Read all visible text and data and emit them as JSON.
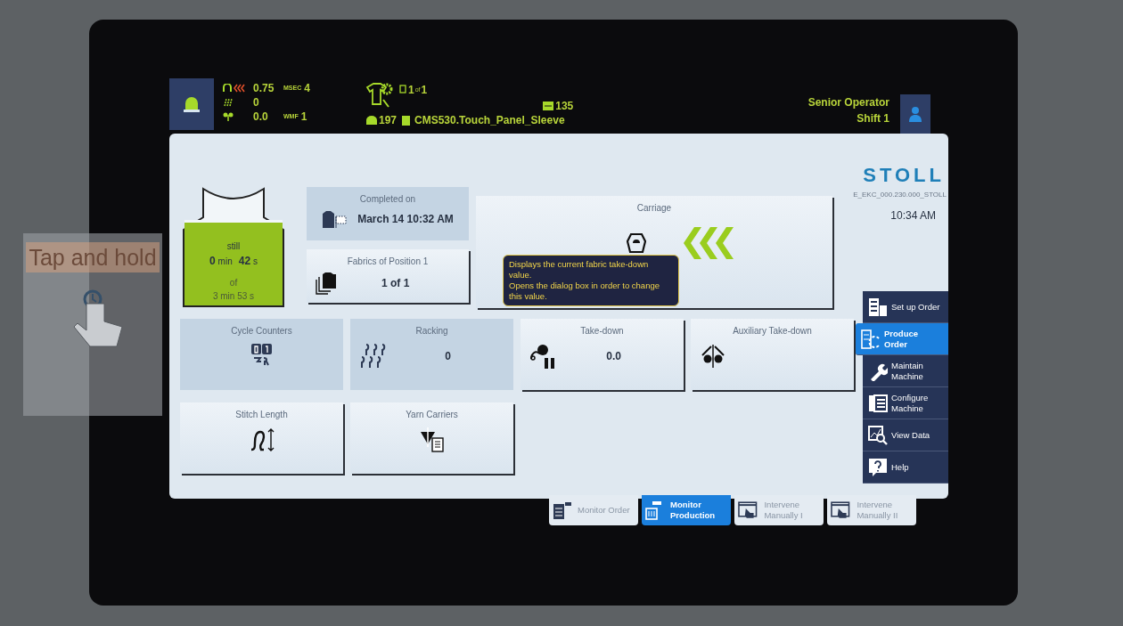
{
  "hint": {
    "text": "Tap and hold"
  },
  "status_bar": {
    "light_on": true,
    "stats": [
      {
        "kind": "speed",
        "value": "0.75",
        "label": "MSEC",
        "label_value": "4"
      },
      {
        "kind": "count",
        "value": "0"
      },
      {
        "kind": "takedown",
        "value": "0.0",
        "label": "WMF",
        "label_value": "1"
      }
    ],
    "pages": {
      "current": "1",
      "of": "of",
      "total": "1"
    },
    "carriage_count": "197",
    "program": "CMS530.Touch_Panel_Sleeve",
    "piece_count": "135",
    "user": {
      "role": "Senior Operator",
      "shift": "Shift 1"
    }
  },
  "brand": "STOLL",
  "machine_id": "E_EKC_000.230.000_STOLL",
  "time": "10:34 AM",
  "progress": {
    "level": 0.97,
    "still": "still",
    "minutes": "0",
    "min": "min",
    "seconds": "42",
    "s": "s",
    "of": "of",
    "total": "3 min 53 s"
  },
  "completed": {
    "title": "Completed on",
    "value": "March 14 10:32 AM",
    "flat": true
  },
  "fabrics": {
    "title": "Fabrics of Position 1",
    "value": "1 of 1",
    "flat": false
  },
  "carriage": {
    "title": "Carriage",
    "flat": false
  },
  "tooltip": {
    "lines": [
      "Displays the current fabric take-down value.",
      "Opens the dialog box in order to change this value."
    ]
  },
  "tiles": [
    {
      "kind": "counters",
      "title": "Cycle Counters",
      "flat": true
    },
    {
      "kind": "racking",
      "title": "Racking",
      "value": "0",
      "flat": true
    },
    {
      "kind": "takedown",
      "title": "Take-down",
      "value": "0.0",
      "flat": false
    },
    {
      "kind": "aux",
      "title": "Auxiliary Take-down",
      "flat": false
    },
    {
      "kind": "stitch",
      "title": "Stitch Length",
      "flat": false
    },
    {
      "kind": "yarn",
      "title": "Yarn Carriers",
      "flat": false
    }
  ],
  "nav": [
    {
      "kind": "setup",
      "label": "Set up Order",
      "selected": false
    },
    {
      "kind": "produce",
      "label": "Produce Order",
      "selected": true
    },
    {
      "kind": "maintain",
      "label": "Maintain Machine",
      "selected": false
    },
    {
      "kind": "configure",
      "label": "Configure Machine",
      "selected": false
    },
    {
      "kind": "view",
      "label": "View Data",
      "selected": false
    },
    {
      "kind": "help",
      "label": "Help",
      "selected": false
    }
  ],
  "tabs": [
    {
      "kind": "order",
      "label": "Monitor Order",
      "selected": false
    },
    {
      "kind": "production",
      "label": "Monitor Production",
      "selected": true
    },
    {
      "kind": "intervene",
      "label": "Intervene Manually I",
      "selected": false
    },
    {
      "kind": "intervene",
      "label": "Intervene Manually II",
      "selected": false
    }
  ]
}
